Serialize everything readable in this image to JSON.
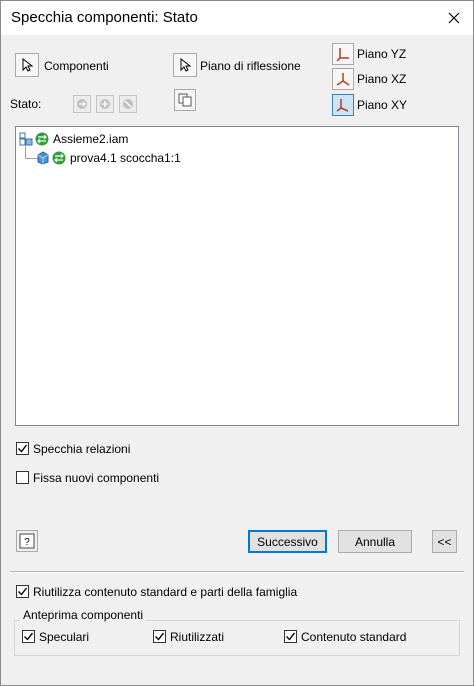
{
  "title": "Specchia componenti: Stato",
  "select": {
    "components_label": "Componenti",
    "mirror_plane_label": "Piano di riflessione"
  },
  "planes": [
    {
      "label": "Piano YZ",
      "selected": false
    },
    {
      "label": "Piano XZ",
      "selected": false
    },
    {
      "label": "Piano XY",
      "selected": true
    }
  ],
  "status_label": "Stato:",
  "tree": {
    "root": "Assieme2.iam",
    "child": "prova4.1 scoccha1:1"
  },
  "options": {
    "mirror_relations": {
      "label": "Specchia relazioni",
      "checked": true
    },
    "fix_new": {
      "label": "Fissa nuovi componenti",
      "checked": false
    }
  },
  "buttons": {
    "help": "?",
    "next": "Successivo",
    "cancel": "Annulla",
    "collapse": "<<"
  },
  "reuse": {
    "label": "Riutilizza contenuto standard e parti della famiglia",
    "checked": true
  },
  "preview": {
    "title": "Anteprima componenti",
    "items": [
      {
        "label": "Speculari",
        "checked": true
      },
      {
        "label": "Riutilizzati",
        "checked": true
      },
      {
        "label": "Contenuto standard",
        "checked": true
      }
    ]
  }
}
